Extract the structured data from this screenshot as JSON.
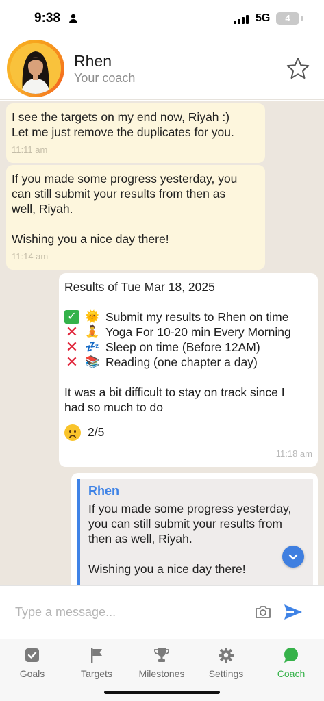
{
  "status_bar": {
    "time": "9:38",
    "network": "5G",
    "battery": "4"
  },
  "header": {
    "coach_name": "Rhen",
    "coach_role": "Your coach"
  },
  "messages": [
    {
      "lines": [
        "I see the targets on my end now, Riyah :)",
        "Let me just remove the duplicates for you."
      ],
      "time": "11:11 am"
    },
    {
      "lines": [
        "If you made some progress yesterday, you",
        "can still submit your results from then as",
        "well, Riyah.",
        "",
        "Wishing you a nice day there!"
      ],
      "time": "11:14 am"
    }
  ],
  "results_message": {
    "title": "Results of Tue Mar 18, 2025",
    "tasks": [
      {
        "status": "done",
        "emoji": "🌞",
        "text": "Submit my results to Rhen on time"
      },
      {
        "status": "fail",
        "emoji": "🧘",
        "text": "Yoga For 10-20 min Every Morning"
      },
      {
        "status": "fail",
        "emoji": "💤",
        "text": "Sleep on time (Before 12AM)"
      },
      {
        "status": "fail",
        "emoji": "📚",
        "text": "Reading (one chapter a day)"
      }
    ],
    "note_lines": [
      "It was a bit difficult to stay on track since I",
      "had so much to do"
    ],
    "score": "2/5",
    "time": "11:18 am"
  },
  "quoted_reply": {
    "author": "Rhen",
    "lines": [
      "If you made some progress yesterday,",
      "you can still submit your results from",
      "then as well, Riyah.",
      "",
      "Wishing you a nice day there!"
    ]
  },
  "composer": {
    "placeholder": "Type a message..."
  },
  "tabs": [
    {
      "label": "Goals",
      "icon": "check-square-icon",
      "active": false
    },
    {
      "label": "Targets",
      "icon": "flag-icon",
      "active": false
    },
    {
      "label": "Milestones",
      "icon": "trophy-icon",
      "active": false
    },
    {
      "label": "Settings",
      "icon": "gear-icon",
      "active": false
    },
    {
      "label": "Coach",
      "icon": "chat-bubble-icon",
      "active": true
    }
  ],
  "colors": {
    "accent_blue": "#3f83e6",
    "active_green": "#36b24a",
    "incoming_bubble": "#fdf6dd",
    "chat_background": "#ece6de"
  }
}
